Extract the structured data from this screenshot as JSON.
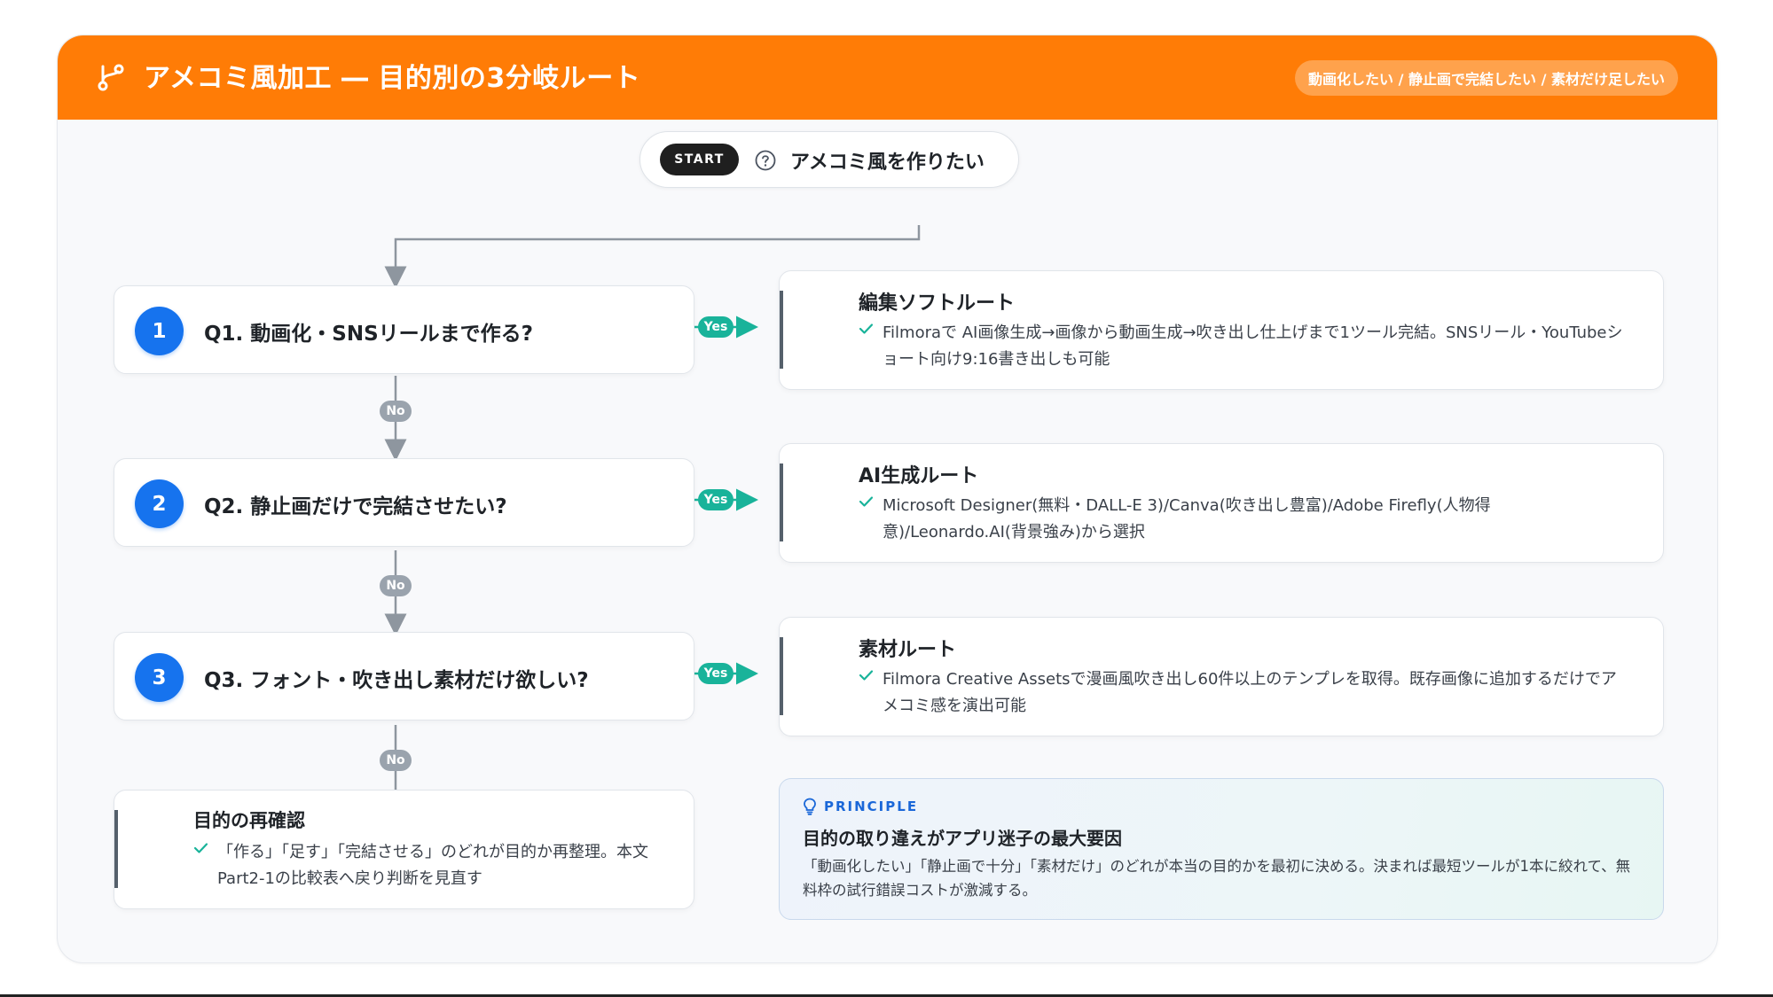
{
  "header": {
    "icon": "branch-icon",
    "title": "アメコミ風加工 ― 目的別の3分岐ルート",
    "pill": "動画化したい / 静止画で完結したい / 素材だけ足したい",
    "color": "#ff7c06"
  },
  "start": {
    "badge": "START",
    "icon": "question-circle-icon",
    "text": "アメコミ風を作りたい"
  },
  "questions": [
    {
      "num": "1",
      "text": "Q1. 動画化・SNSリールまで作る?"
    },
    {
      "num": "2",
      "text": "Q2. 静止画だけで完結させたい?"
    },
    {
      "num": "3",
      "text": "Q3. フォント・吹き出し素材だけ欲しい?"
    }
  ],
  "labels": {
    "yes": "Yes",
    "no": "No"
  },
  "routes": [
    {
      "title": "編集ソフトルート",
      "desc": "Filmoraで AI画像生成→画像から動画生成→吹き出し仕上げまで1ツール完結。SNSリール・YouTubeショート向け9:16書き出しも可能"
    },
    {
      "title": "AI生成ルート",
      "desc": "Microsoft Designer(無料・DALL-E 3)/Canva(吹き出し豊富)/Adobe Firefly(人物得意)/Leonardo.AI(背景強み)から選択"
    },
    {
      "title": "素材ルート",
      "desc": "Filmora Creative Assetsで漫画風吹き出し60件以上のテンプレを取得。既存画像に追加するだけでアメコミ感を演出可能"
    }
  ],
  "recheck": {
    "title": "目的の再確認",
    "desc": "「作る」「足す」「完結させる」のどれが目的か再整理。本文Part2-1の比較表へ戻り判断を見直す"
  },
  "principle": {
    "icon": "lightbulb-icon",
    "label": "PRINCIPLE",
    "title": "目的の取り違えがアプリ迷子の最大要因",
    "desc": "「動画化したい」「静止画で十分」「素材だけ」のどれが本当の目的かを最初に決める。決まれば最短ツールが1本に絞れて、無料枠の試行錯誤コストが激減する。"
  },
  "colors": {
    "accent_blue": "#1673ee",
    "yes_green": "#19b39a",
    "no_gray": "#9aa3ad"
  }
}
